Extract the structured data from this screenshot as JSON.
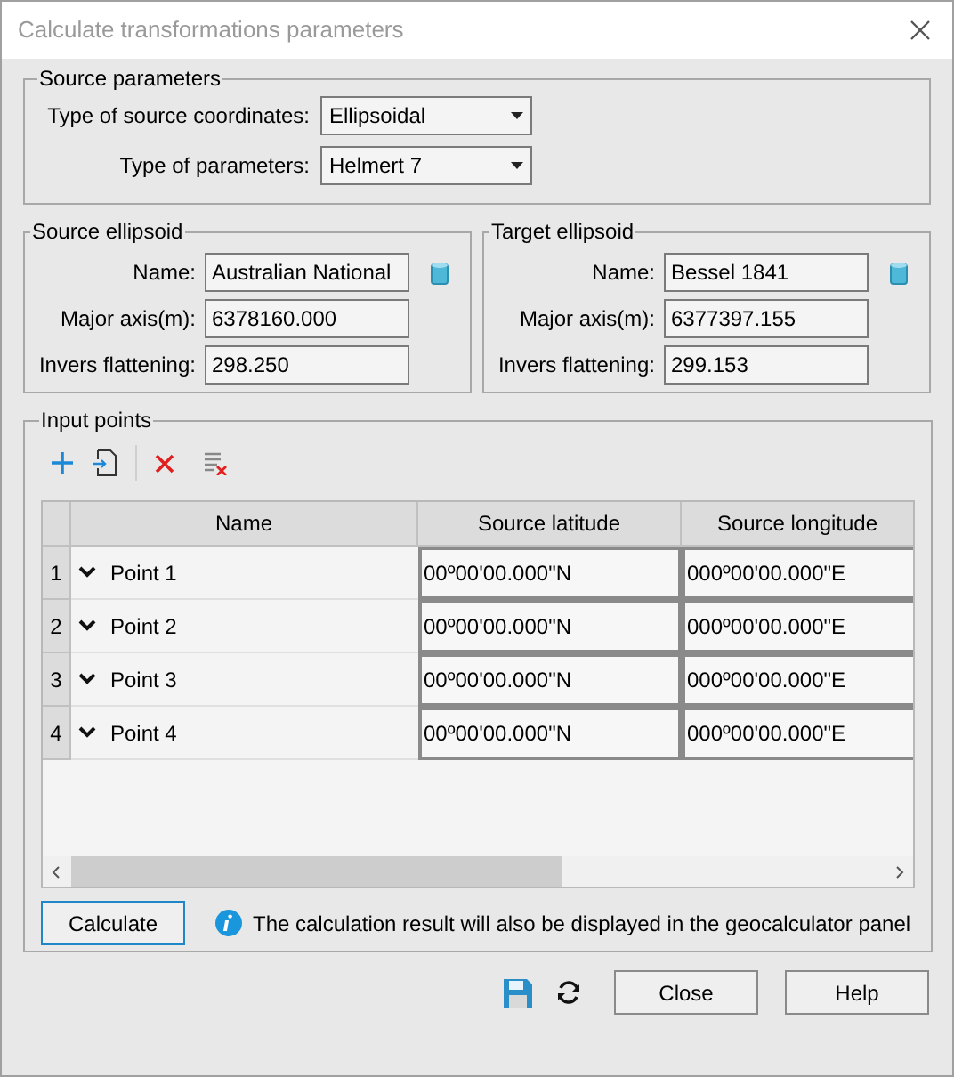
{
  "window": {
    "title": "Calculate transformations parameters"
  },
  "source_parameters": {
    "title": "Source parameters",
    "fields": [
      {
        "label": "Type of source coordinates:",
        "value": "Ellipsoidal"
      },
      {
        "label": "Type of parameters:",
        "value": "Helmert 7"
      }
    ]
  },
  "ellipsoids": [
    {
      "title": "Source ellipsoid",
      "fields": [
        {
          "label": "Name:",
          "value": "Australian National"
        },
        {
          "label": "Major axis(m):",
          "value": "6378160.000"
        },
        {
          "label": "Invers flattening:",
          "value": "298.250"
        }
      ]
    },
    {
      "title": "Target ellipsoid",
      "fields": [
        {
          "label": "Name:",
          "value": "Bessel 1841"
        },
        {
          "label": "Major axis(m):",
          "value": "6377397.155"
        },
        {
          "label": "Invers flattening:",
          "value": "299.153"
        }
      ]
    }
  ],
  "input_points": {
    "title": "Input points",
    "table": {
      "columns": [
        "Name",
        "Source latitude",
        "Source longitude"
      ],
      "rows": [
        {
          "number": "1",
          "name": "Point 1",
          "latitude": "00º00'00.000\"N",
          "longitude": "000º00'00.000\"E"
        },
        {
          "number": "2",
          "name": "Point 2",
          "latitude": "00º00'00.000\"N",
          "longitude": "000º00'00.000\"E"
        },
        {
          "number": "3",
          "name": "Point 3",
          "latitude": "00º00'00.000\"N",
          "longitude": "000º00'00.000\"E"
        },
        {
          "number": "4",
          "name": "Point 4",
          "latitude": "00º00'00.000\"N",
          "longitude": "000º00'00.000\"E"
        }
      ]
    },
    "calculate_button": "Calculate",
    "info_text": "The calculation result will also be displayed in the geocalculator panel"
  },
  "buttons": [
    "Close",
    "Help"
  ]
}
